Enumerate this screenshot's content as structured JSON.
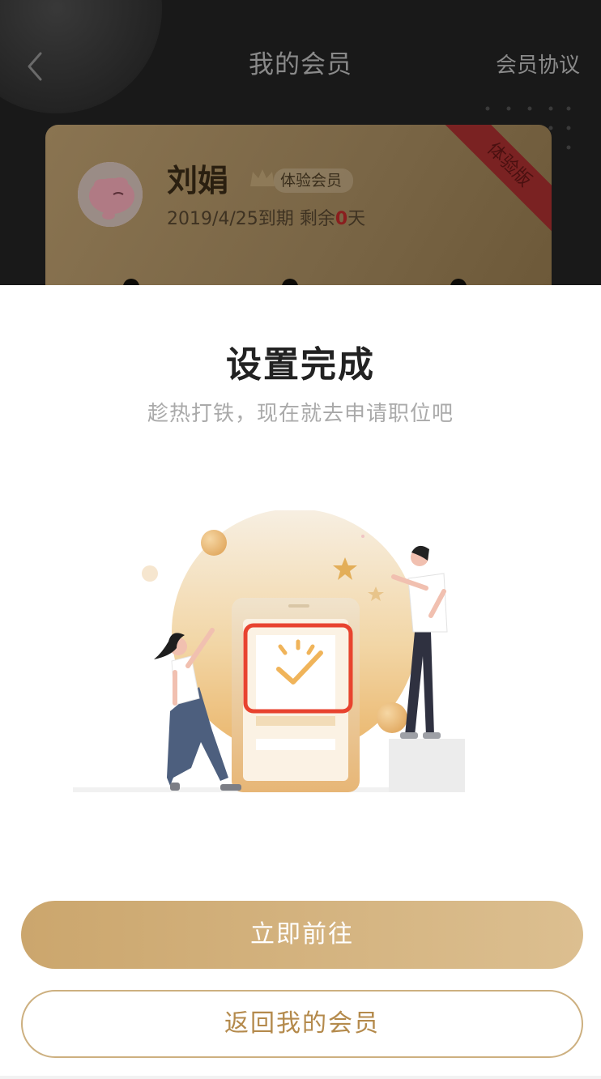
{
  "header": {
    "title": "我的会员",
    "agreement_link": "会员协议"
  },
  "member_card": {
    "name": "刘娟",
    "badge": "体验会员",
    "expiry_date": "2019/4/25到期",
    "remaining_label": "剩余",
    "remaining_days": "0",
    "remaining_unit": "天",
    "ribbon": "体验版"
  },
  "sheet": {
    "title": "设置完成",
    "subtitle": "趁热打铁，现在就去申请职位吧",
    "primary_button": "立即前往",
    "secondary_button": "返回我的会员"
  },
  "colors": {
    "accent_gold": "#cba66d",
    "secondary_text_gold": "#b48a4c",
    "highlight_red": "#e8432f"
  },
  "icons": [
    "back-icon",
    "crown-icon",
    "check-icon"
  ]
}
